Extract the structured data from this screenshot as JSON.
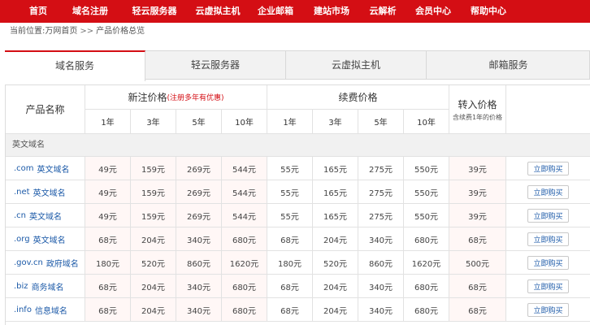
{
  "nav": [
    "首页",
    "域名注册",
    "轻云服务器",
    "云虚拟主机",
    "企业邮箱",
    "建站市场",
    "云解析",
    "会员中心",
    "帮助中心"
  ],
  "breadcrumb": {
    "prefix": "当前位置:",
    "home": "万网首页",
    "sep": ">>",
    "current": "产品价格总览"
  },
  "tabs": [
    "域名服务",
    "轻云服务器",
    "云虚拟主机",
    "邮箱服务"
  ],
  "table": {
    "col_name": "产品名称",
    "new_price": "新注价格",
    "new_note": "(注册多年有优惠)",
    "renew_price": "续费价格",
    "transfer_price": "转入价格",
    "transfer_note": "含续费1年的价格",
    "years": [
      "1年",
      "3年",
      "5年",
      "10年"
    ],
    "section": "英文域名",
    "buy_label": "立即购买",
    "rows": [
      {
        "domain": ".com",
        "desc": "英文域名",
        "new": [
          "49元",
          "159元",
          "269元",
          "544元"
        ],
        "renew": [
          "55元",
          "165元",
          "275元",
          "550元"
        ],
        "transfer": "39元"
      },
      {
        "domain": ".net",
        "desc": "英文域名",
        "new": [
          "49元",
          "159元",
          "269元",
          "544元"
        ],
        "renew": [
          "55元",
          "165元",
          "275元",
          "550元"
        ],
        "transfer": "39元"
      },
      {
        "domain": ".cn",
        "desc": "英文域名",
        "new": [
          "49元",
          "159元",
          "269元",
          "544元"
        ],
        "renew": [
          "55元",
          "165元",
          "275元",
          "550元"
        ],
        "transfer": "39元"
      },
      {
        "domain": ".org",
        "desc": "英文域名",
        "new": [
          "68元",
          "204元",
          "340元",
          "680元"
        ],
        "renew": [
          "68元",
          "204元",
          "340元",
          "680元"
        ],
        "transfer": "68元"
      },
      {
        "domain": ".gov.cn",
        "desc": "政府域名",
        "new": [
          "180元",
          "520元",
          "860元",
          "1620元"
        ],
        "renew": [
          "180元",
          "520元",
          "860元",
          "1620元"
        ],
        "transfer": "500元"
      },
      {
        "domain": ".biz",
        "desc": "商务域名",
        "new": [
          "68元",
          "204元",
          "340元",
          "680元"
        ],
        "renew": [
          "68元",
          "204元",
          "340元",
          "680元"
        ],
        "transfer": "68元"
      },
      {
        "domain": ".info",
        "desc": "信息域名",
        "new": [
          "68元",
          "204元",
          "340元",
          "680元"
        ],
        "renew": [
          "68元",
          "204元",
          "340元",
          "680元"
        ],
        "transfer": "68元"
      }
    ]
  }
}
